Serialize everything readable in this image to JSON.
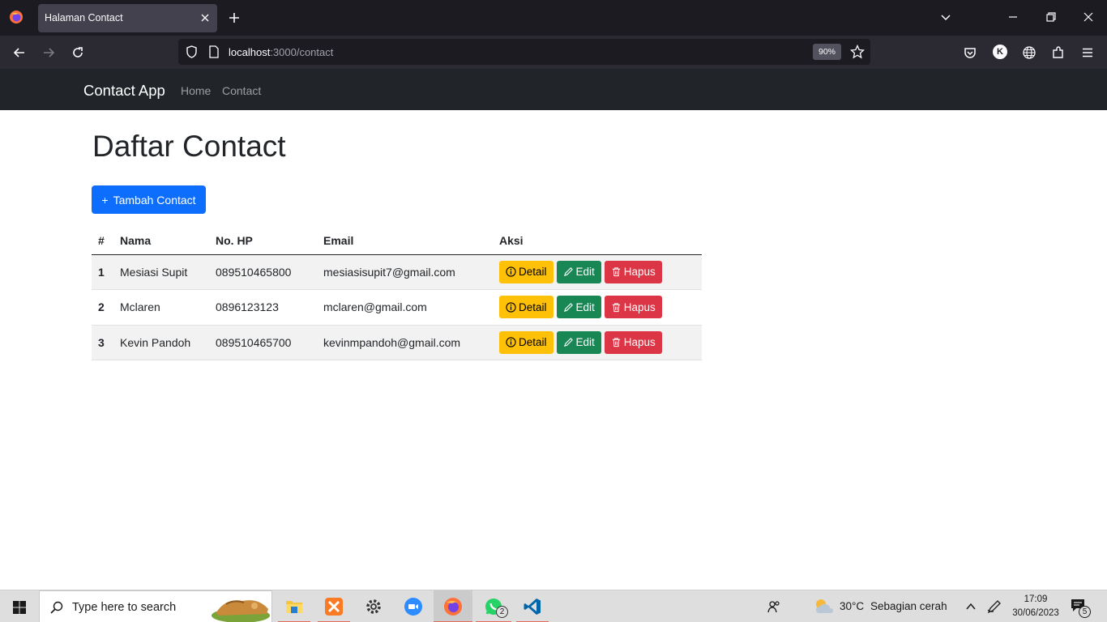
{
  "browser": {
    "tab_title": "Halaman Contact",
    "url_host": "localhost",
    "url_rest": ":3000/contact",
    "zoom": "90%",
    "account_initial": "K"
  },
  "site": {
    "brand": "Contact App",
    "nav": [
      "Home",
      "Contact"
    ]
  },
  "page": {
    "title": "Daftar Contact",
    "add_button": "Tambah Contact",
    "add_button_icon": "+"
  },
  "table": {
    "headers": [
      "#",
      "Nama",
      "No. HP",
      "Email",
      "Aksi"
    ],
    "rows": [
      {
        "no": "1",
        "nama": "Mesiasi Supit",
        "hp": "089510465800",
        "email": "mesiasisupit7@gmail.com"
      },
      {
        "no": "2",
        "nama": "Mclaren",
        "hp": "0896123123",
        "email": "mclaren@gmail.com"
      },
      {
        "no": "3",
        "nama": "Kevin Pandoh",
        "hp": "089510465700",
        "email": "kevinmpandoh@gmail.com"
      }
    ],
    "actions": {
      "detail": "Detail",
      "edit": "Edit",
      "hapus": "Hapus"
    }
  },
  "taskbar": {
    "search_placeholder": "Type here to search",
    "weather_temp": "30°C",
    "weather_text": "Sebagian cerah",
    "time": "17:09",
    "date": "30/06/2023",
    "whatsapp_badge": "2",
    "notification_count": "5"
  },
  "colors": {
    "primary": "#0d6efd",
    "warning": "#ffc107",
    "success": "#198754",
    "danger": "#dc3545",
    "navbar_dark": "#212529"
  }
}
